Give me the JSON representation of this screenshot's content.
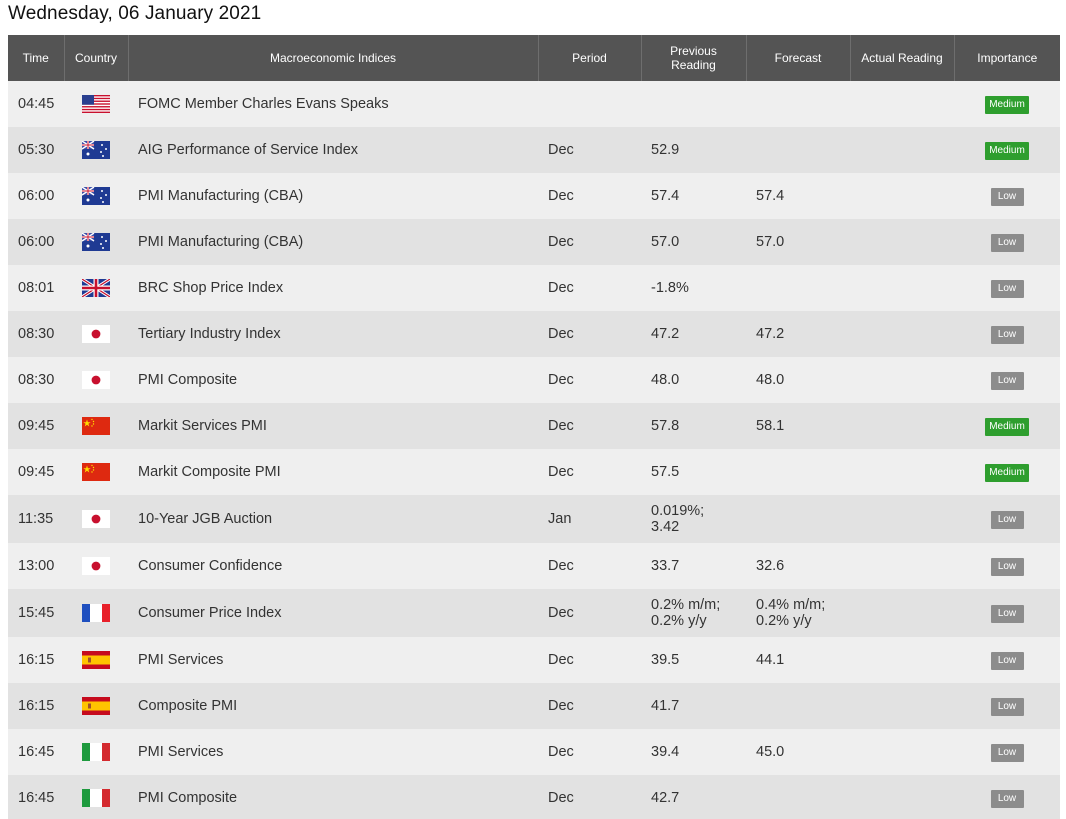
{
  "page_title": "Wednesday, 06 January 2021",
  "columns": {
    "time": "Time",
    "country": "Country",
    "indices": "Macroeconomic Indices",
    "period": "Period",
    "previous_line1": "Previous",
    "previous_line2": "Reading",
    "forecast": "Forecast",
    "actual": "Actual Reading",
    "importance": "Importance"
  },
  "rows": [
    {
      "time": "04:45",
      "flag": "us-flag-icon",
      "index": "FOMC Member Charles Evans Speaks",
      "period": "",
      "previous": "",
      "forecast": "",
      "actual": "",
      "importance": "Medium"
    },
    {
      "time": "05:30",
      "flag": "australia-flag-icon",
      "index": "AIG Performance of Service Index",
      "period": "Dec",
      "previous": "52.9",
      "forecast": "",
      "actual": "",
      "importance": "Medium"
    },
    {
      "time": "06:00",
      "flag": "australia-flag-icon",
      "index": "PMI Manufacturing (CBA)",
      "period": "Dec",
      "previous": "57.4",
      "forecast": "57.4",
      "actual": "",
      "importance": "Low"
    },
    {
      "time": "06:00",
      "flag": "australia-flag-icon",
      "index": "PMI Manufacturing (CBA)",
      "period": "Dec",
      "previous": "57.0",
      "forecast": "57.0",
      "actual": "",
      "importance": "Low"
    },
    {
      "time": "08:01",
      "flag": "uk-flag-icon",
      "index": "BRC Shop Price Index",
      "period": "Dec",
      "previous": "-1.8%",
      "forecast": "",
      "actual": "",
      "importance": "Low"
    },
    {
      "time": "08:30",
      "flag": "japan-flag-icon",
      "index": "Tertiary Industry Index",
      "period": "Dec",
      "previous": "47.2",
      "forecast": "47.2",
      "actual": "",
      "importance": "Low"
    },
    {
      "time": "08:30",
      "flag": "japan-flag-icon",
      "index": "PMI Composite",
      "period": "Dec",
      "previous": "48.0",
      "forecast": "48.0",
      "actual": "",
      "importance": "Low"
    },
    {
      "time": "09:45",
      "flag": "china-flag-icon",
      "index": "Markit Services PMI",
      "period": "Dec",
      "previous": "57.8",
      "forecast": "58.1",
      "actual": "",
      "importance": "Medium"
    },
    {
      "time": "09:45",
      "flag": "china-flag-icon",
      "index": "Markit Composite PMI",
      "period": "Dec",
      "previous": "57.5",
      "forecast": "",
      "actual": "",
      "importance": "Medium"
    },
    {
      "time": "11:35",
      "flag": "japan-flag-icon",
      "index": "10-Year JGB Auction",
      "period": "Jan",
      "previous": "0.019%; 3.42",
      "forecast": "",
      "actual": "",
      "importance": "Low"
    },
    {
      "time": "13:00",
      "flag": "japan-flag-icon",
      "index": "Consumer Confidence",
      "period": "Dec",
      "previous": "33.7",
      "forecast": "32.6",
      "actual": "",
      "importance": "Low"
    },
    {
      "time": "15:45",
      "flag": "france-flag-icon",
      "index": "Consumer Price Index",
      "period": "Dec",
      "previous": "0.2% m/m; 0.2% y/y",
      "forecast": "0.4% m/m; 0.2% y/y",
      "actual": "",
      "importance": "Low"
    },
    {
      "time": "16:15",
      "flag": "spain-flag-icon",
      "index": "PMI Services",
      "period": "Dec",
      "previous": "39.5",
      "forecast": "44.1",
      "actual": "",
      "importance": "Low"
    },
    {
      "time": "16:15",
      "flag": "spain-flag-icon",
      "index": "Composite PMI",
      "period": "Dec",
      "previous": "41.7",
      "forecast": "",
      "actual": "",
      "importance": "Low"
    },
    {
      "time": "16:45",
      "flag": "italy-flag-icon",
      "index": "PMI Services",
      "period": "Dec",
      "previous": "39.4",
      "forecast": "45.0",
      "actual": "",
      "importance": "Low"
    },
    {
      "time": "16:45",
      "flag": "italy-flag-icon",
      "index": "PMI Composite",
      "period": "Dec",
      "previous": "42.7",
      "forecast": "",
      "actual": "",
      "importance": "Low"
    }
  ],
  "colors": {
    "header_bg": "#545454",
    "row_light": "#efefef",
    "row_dark": "#e2e2e2",
    "medium_badge": "#2e9e2e",
    "low_badge": "#8c8c8c"
  }
}
